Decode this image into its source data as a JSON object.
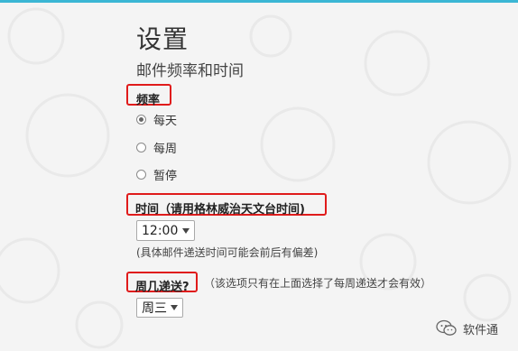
{
  "page": {
    "title": "设置",
    "subtitle": "邮件频率和时间"
  },
  "frequency": {
    "heading": "频率",
    "options": [
      {
        "label": "每天",
        "selected": true
      },
      {
        "label": "每周",
        "selected": false
      },
      {
        "label": "暂停",
        "selected": false
      }
    ]
  },
  "time": {
    "heading": "时间（请用格林威治天文台时间)",
    "selected_value": "12:00",
    "note": "(具体邮件递送时间可能会前后有偏差)"
  },
  "weekday": {
    "heading": "周几递送?",
    "note": "（该选项只有在上面选择了每周递送才会有效）",
    "selected_value": "周三"
  },
  "watermark": {
    "text": "软件通",
    "icon": "wechat-bubble-icon"
  },
  "colors": {
    "highlight_border": "#e01b1b",
    "top_accent": "#3bb6d4",
    "background": "#f4f4f4"
  }
}
